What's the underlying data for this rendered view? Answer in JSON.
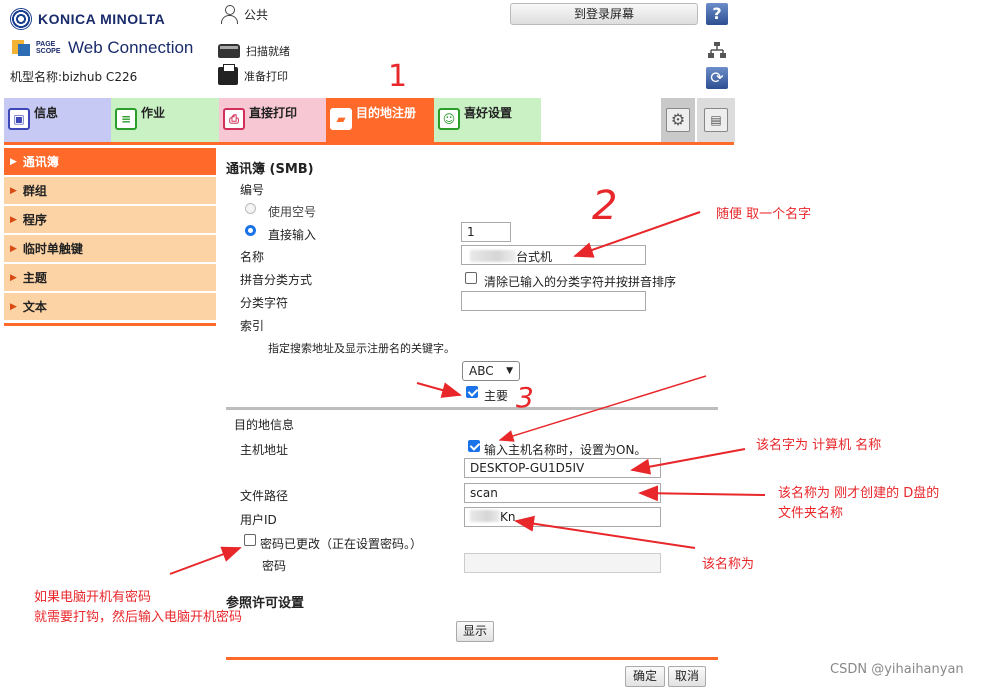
{
  "header": {
    "brand": "KONICA MINOLTA",
    "product_mark": "PAGE SCOPE",
    "product": "Web Connection",
    "model_label": "机型名称:bizhub C226",
    "user": "公共",
    "login_button": "到登录屏幕",
    "help_button": "?",
    "status_scan": "扫描就绪",
    "status_print": "准备打印"
  },
  "tabs": [
    {
      "label": "信息",
      "icon": "info-icon"
    },
    {
      "label": "作业",
      "icon": "job-icon"
    },
    {
      "label": "直接打印",
      "icon": "print-icon"
    },
    {
      "label": "目的地注册",
      "icon": "folder-icon"
    },
    {
      "label": "喜好设置",
      "icon": "favorites-icon"
    }
  ],
  "sidebar": {
    "items": [
      {
        "label": "通讯簿",
        "active": true
      },
      {
        "label": "群组"
      },
      {
        "label": "程序"
      },
      {
        "label": "临时单触键"
      },
      {
        "label": "主题"
      },
      {
        "label": "文本"
      }
    ]
  },
  "form": {
    "title": "通讯簿 (SMB)",
    "number_label": "编号",
    "use_empty": "使用空号",
    "direct_input": "直接输入",
    "number_value": "1",
    "name_label": "名称",
    "name_value": "台式机",
    "pinyin_label": "拼音分类方式",
    "pinyin_option": "清除已输入的分类字符并按拼音排序",
    "category_label": "分类字符",
    "category_value": "",
    "index_label": "索引",
    "index_hint": "指定搜索地址及显示注册名的关键字。",
    "index_select": "ABC",
    "main_label": "主要",
    "dest_section": "目的地信息",
    "host_label": "主机地址",
    "host_checkbox": "输入主机名称时，设置为ON。",
    "host_value": "DESKTOP-GU1D5IV",
    "path_label": "文件路径",
    "path_value": "scan",
    "userid_label": "用户ID",
    "userid_value": "Kn",
    "pwd_changed": "密码已更改（正在设置密码。）",
    "pwd_label": "密码",
    "pwd_value": "",
    "ref_title": "参照许可设置",
    "show_button": "显示",
    "ok_button": "确定",
    "cancel_button": "取消"
  },
  "annotations": {
    "a1": "随便 取一个名字",
    "a2": "该名字为 计算机 名称",
    "a3_line1": "该名称为 刚才创建的 D盘的",
    "a3_line2": "文件夹名称",
    "a4": "该名称为",
    "a5_line1": "如果电脑开机有密码",
    "a5_line2": "就需要打钩，然后输入电脑开机密码",
    "num1": "1",
    "num2": "2",
    "num3": "3"
  },
  "watermark": "CSDN @yihaihanyan",
  "colors": {
    "accent": "#ff6a2b",
    "annotation": "#e8272b",
    "sidebar": "#fcd3a5"
  }
}
